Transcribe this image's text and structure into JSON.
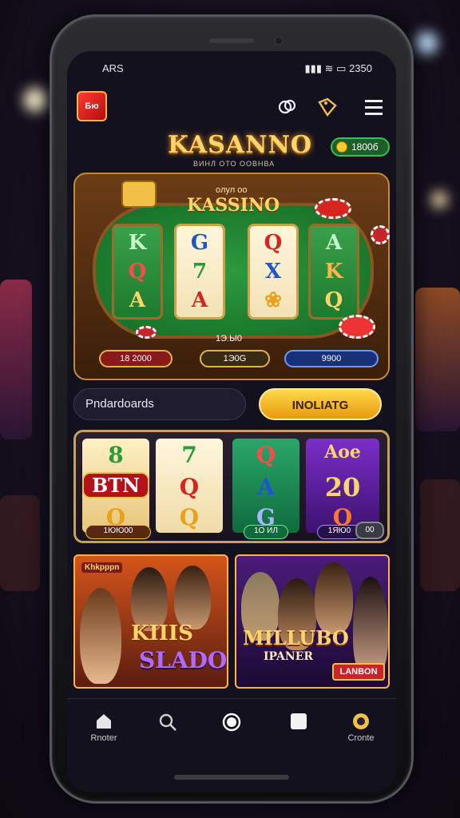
{
  "status_bar": {
    "carrier": "ARS",
    "time": "2350"
  },
  "topbar": {
    "app_logo_text": "Бю",
    "icons": [
      "people-icon",
      "tag-icon",
      "menu-icon"
    ]
  },
  "brand": {
    "title": "KASANNO",
    "subtitle": "ВИНЛ ОТО ООВНВА"
  },
  "coins": {
    "balance": "1800б"
  },
  "table": {
    "header_small": "oлул оо",
    "title": "KASSINO",
    "reels": [
      {
        "top": "K",
        "mid": "Q",
        "bottom": "A"
      },
      {
        "top": "G",
        "mid": "7",
        "bottom": "A"
      },
      {
        "top": "Q",
        "mid": "X",
        "bottom": "❀"
      },
      {
        "top": "A",
        "mid": "K",
        "bottom": "Q"
      }
    ],
    "center_label": "1Э.Ы0",
    "pills": [
      "18 2000",
      "1Э0G",
      "9900"
    ]
  },
  "search": {
    "placeholder": "Pndardoards",
    "button_label": "INOLIATG"
  },
  "slot_banner": {
    "reels": [
      {
        "top": "8",
        "mid": "BTN",
        "bottom": "Q"
      },
      {
        "top": "7",
        "mid": "Q",
        "bottom": "Q"
      },
      {
        "top": "Q",
        "mid": "A",
        "bottom": "G"
      },
      {
        "top": "Aoe",
        "mid": "20",
        "bottom": "Q"
      }
    ],
    "pills": [
      "1ЮЮ00",
      "1О ИЛ",
      "1ЯЮ0",
      "00"
    ]
  },
  "cards": [
    {
      "badge": "Khkpppn",
      "title": "KIIIS",
      "subtitle": "SLADO"
    },
    {
      "badge": "",
      "title": "MILLUBO",
      "subtitle": "IPANER",
      "button": "LANBON"
    }
  ],
  "nav": [
    {
      "icon": "home-icon",
      "label": "Rnoter"
    },
    {
      "icon": "search-icon",
      "label": ""
    },
    {
      "icon": "record-icon",
      "label": ""
    },
    {
      "icon": "square-icon",
      "label": ""
    },
    {
      "icon": "coin-icon",
      "label": "Cronte"
    }
  ],
  "colors": {
    "accent_gold": "#ffd56a",
    "button_yellow": "#ffc52a",
    "felt_green": "#2c9a3e",
    "screen_bg": "#13111d"
  }
}
